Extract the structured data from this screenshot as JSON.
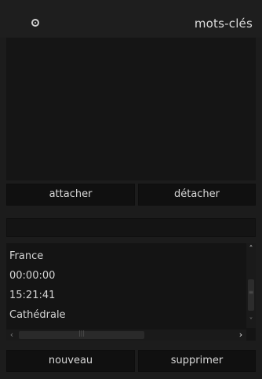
{
  "header": {
    "title": "mots-clés",
    "icon": "pin-icon"
  },
  "taglist": {
    "items": []
  },
  "buttons": {
    "attach": "attacher",
    "detach": "détacher",
    "new": "nouveau",
    "delete": "supprimer"
  },
  "entry": {
    "value": ""
  },
  "dictionary": {
    "items": [
      "France",
      "00:00:00",
      "15:21:41",
      "Cathédrale"
    ]
  },
  "colors": {
    "background": "#1c1c1c",
    "button": "#101010",
    "text": "#d6d6d6"
  }
}
